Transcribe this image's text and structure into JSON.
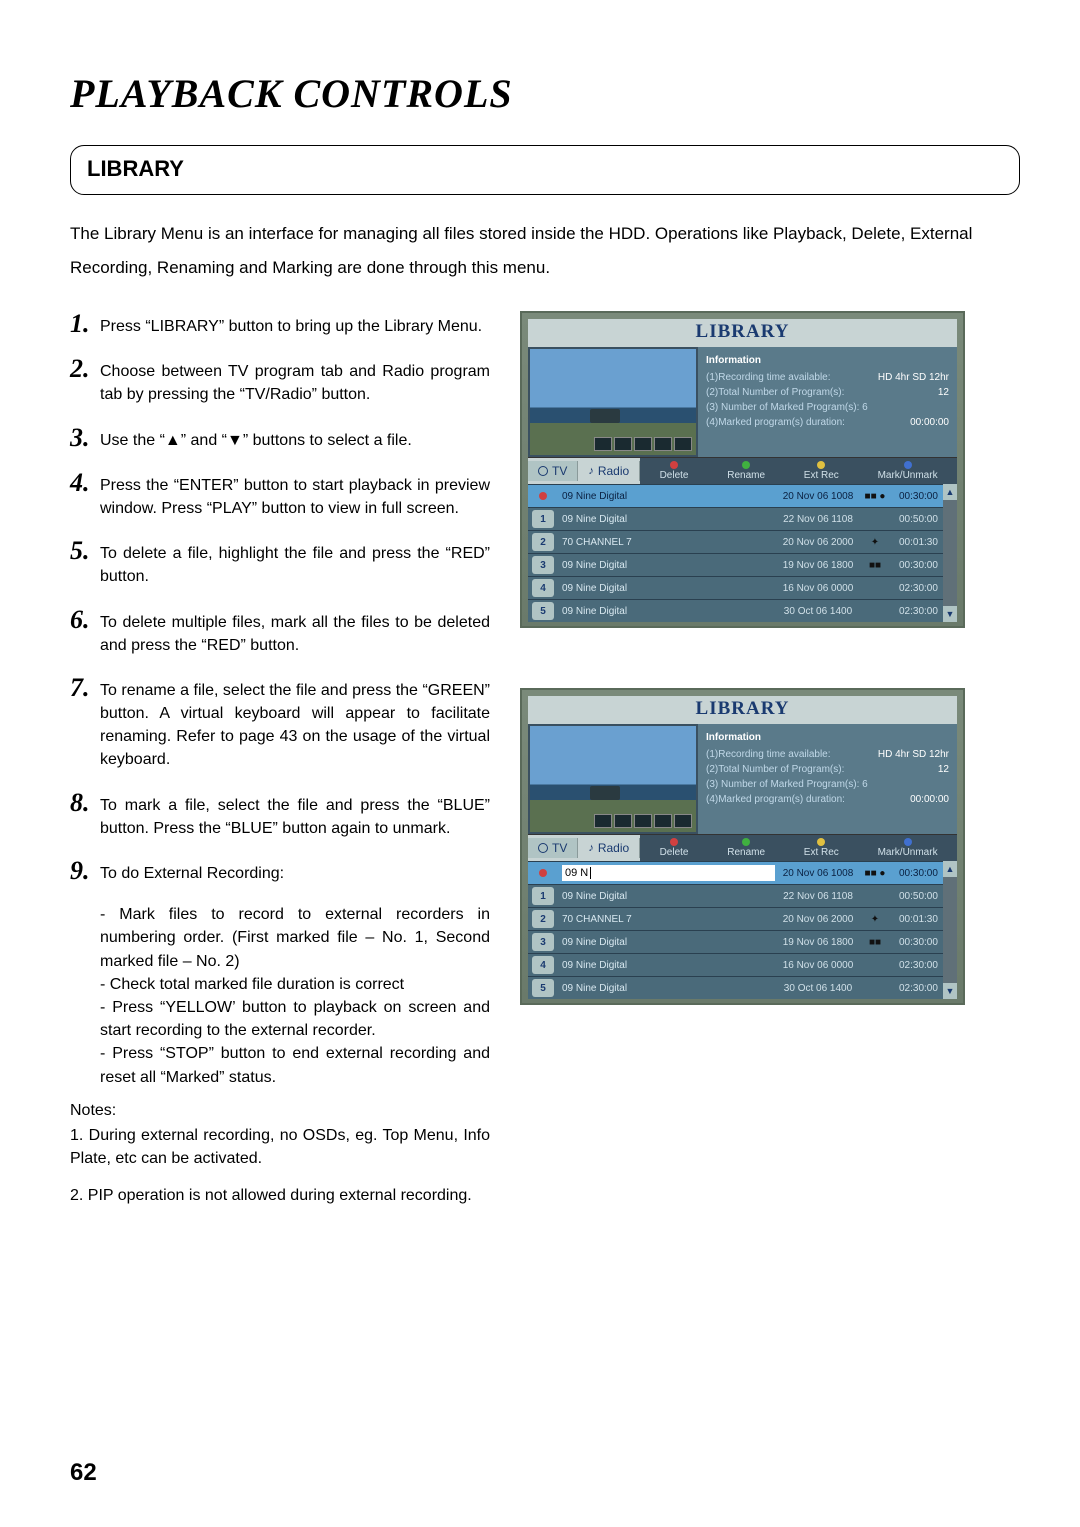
{
  "page_title": "PLAYBACK CONTROLS",
  "section_heading": "LIBRARY",
  "intro": "The Library Menu is an interface for managing all files stored inside the HDD. Operations like Playback, Delete, External Recording, Renaming and Marking are done through this menu.",
  "steps": {
    "s1": "Press “LIBRARY” button to bring up the Library Menu.",
    "s2": "Choose between TV program tab and Radio program tab by pressing the “TV/Radio” button.",
    "s3": "Use the “▲” and “▼” buttons to select a file.",
    "s4": "Press the “ENTER” button to start playback in preview window. Press “PLAY” button to view in full screen.",
    "s5": "To delete a file, highlight the file and press the “RED” button.",
    "s6": "To delete multiple files, mark all the files to be deleted and press the “RED” button.",
    "s7": "To rename a file, select the file and press the “GREEN” button. A virtual keyboard will appear to facilitate renaming. Refer to page 43 on the usage of the virtual keyboard.",
    "s8": "To mark a file, select the file and press the “BLUE” button. Press the “BLUE” button again to unmark.",
    "s9": "To do External Recording:",
    "s9a": "- Mark files to record to external recorders in numbering order. (First marked file – No. 1, Second marked file – No. 2)",
    "s9b": "- Check total marked file duration is correct",
    "s9c": "- Press “YELLOW’ button to playback on screen and start recording to the external recorder.",
    "s9d": "- Press “STOP” button to end external recording and reset all “Marked” status."
  },
  "notes_heading": "Notes:",
  "notes": {
    "n1": "1. During external recording, no OSDs, eg. Top Menu, Info Plate, etc can be activated.",
    "n2": "2. PIP operation is not allowed during external recording."
  },
  "page_number": "62",
  "library": {
    "title": "LIBRARY",
    "info_heading": "Information",
    "info_lines": {
      "l1": "(1)Recording time available:",
      "l1v": "HD 4hr   SD 12hr",
      "l2": "(2)Total Number of Program(s):",
      "l2v": "12",
      "l3": "(3) Number of Marked Program(s): 6",
      "l4": "(4)Marked program(s) duration:",
      "l4v": "00:00:00"
    },
    "tabs": {
      "tv": "TV",
      "radio": "Radio"
    },
    "legend": {
      "del": "Delete",
      "ren": "Rename",
      "ext": "Ext Rec",
      "mark": "Mark/Unmark"
    },
    "rows": [
      {
        "badge": "●",
        "name": "09 Nine Digital",
        "date": "20 Nov 06 1008",
        "lock": "■■ ●",
        "dur": "00:30:00",
        "hl": true,
        "dotcolor": "red"
      },
      {
        "badge": "1",
        "name": "09 Nine Digital",
        "date": "22 Nov 06 1108",
        "lock": "",
        "dur": "00:50:00"
      },
      {
        "badge": "2",
        "name": "70 CHANNEL 7",
        "date": "20 Nov 06 2000",
        "lock": "✦",
        "dur": "00:01:30"
      },
      {
        "badge": "3",
        "name": "09 Nine Digital",
        "date": "19 Nov 06 1800",
        "lock": "■■",
        "dur": "00:30:00"
      },
      {
        "badge": "4",
        "name": "09 Nine Digital",
        "date": "16 Nov 06 0000",
        "lock": "",
        "dur": "02:30:00"
      },
      {
        "badge": "5",
        "name": "09 Nine Digital",
        "date": "30 Oct 06 1400",
        "lock": "",
        "dur": "02:30:00"
      }
    ],
    "rename_value": "09 N"
  }
}
